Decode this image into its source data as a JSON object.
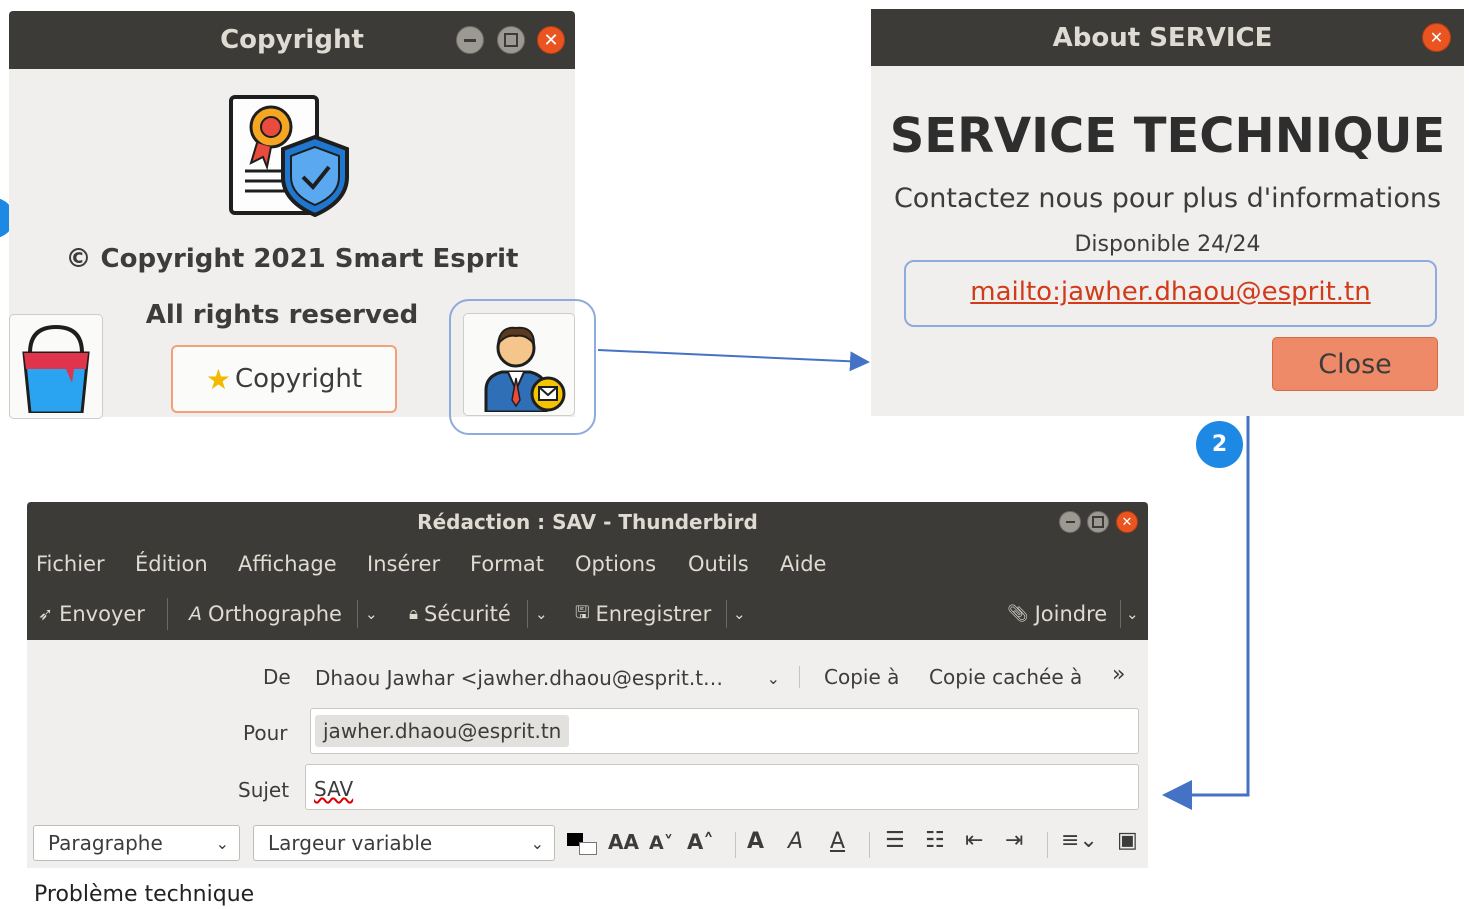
{
  "copyright_window": {
    "title": "Copyright",
    "copyright_line": "© Copyright 2021 Smart Esprit",
    "rights_line": "All rights reserved",
    "copyright_button_label": "Copyright"
  },
  "about_window": {
    "title": "About SERVICE",
    "heading": "SERVICE TECHNIQUE",
    "contact_text": "Contactez nous pour plus d'informations",
    "availability": "Disponible 24/24",
    "mail_link": "mailto:jawher.dhaou@esprit.tn",
    "close_label": "Close"
  },
  "step_badge": "2",
  "compose_window": {
    "title": "Rédaction : SAV - Thunderbird",
    "menu": [
      "Fichier",
      "Édition",
      "Affichage",
      "Insérer",
      "Format",
      "Options",
      "Outils",
      "Aide"
    ],
    "toolbar": {
      "send": "Envoyer",
      "spelling": "Orthographe",
      "security": "Sécurité",
      "save": "Enregistrer",
      "attach": "Joindre"
    },
    "header": {
      "from_label": "De",
      "from_value": "Dhaou Jawhar <jawher.dhaou@esprit.t…",
      "cc": "Copie à",
      "bcc": "Copie cachée à",
      "to_label": "Pour",
      "to_value": "jawher.dhaou@esprit.tn",
      "subject_label": "Sujet",
      "subject_value": "SAV"
    },
    "format_bar": {
      "paragraph_select": "Paragraphe",
      "font_select": "Largeur variable"
    },
    "body_text": "Problème technique"
  },
  "colors": {
    "titlebar": "#3c3b37",
    "window_bg": "#f1efed",
    "accent_orange": "#e95420",
    "annotation_blue": "#4472c4",
    "badge_blue": "#1e88e5"
  }
}
